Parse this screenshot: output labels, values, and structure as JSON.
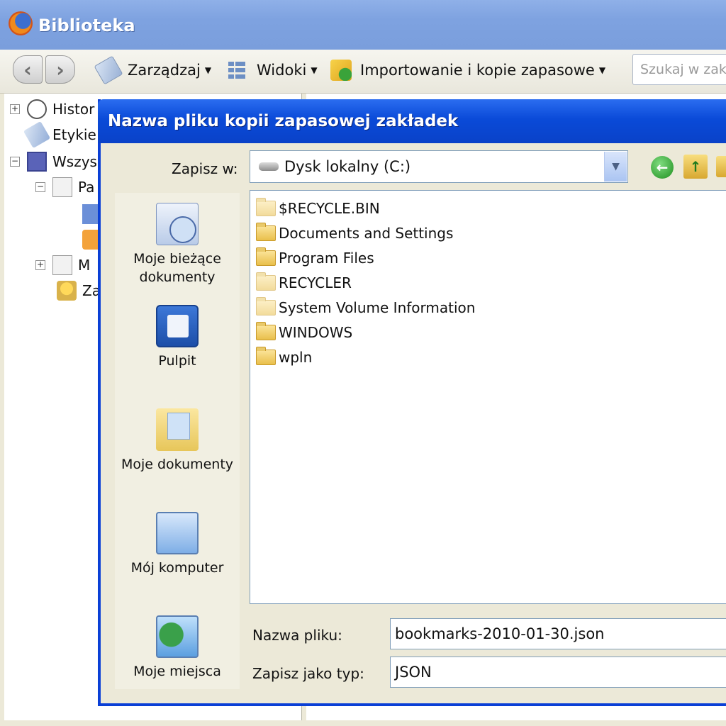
{
  "library": {
    "title": "Biblioteka",
    "toolbar": {
      "back": "‹",
      "forward": "›",
      "organize": "Zarządzaj",
      "views": "Widoki",
      "import_backup": "Importowanie i kopie zapasowe",
      "search_placeholder": "Szukaj w zakł"
    },
    "sidebar": {
      "items": [
        {
          "label": "Histor",
          "expander": "+"
        },
        {
          "label": "Etykie"
        },
        {
          "label": "Wszys",
          "expander": "−"
        },
        {
          "label": "Pa",
          "expander": "−"
        },
        {
          "label": ""
        },
        {
          "label": ""
        },
        {
          "label": "M",
          "expander": "+"
        },
        {
          "label": "Za"
        }
      ]
    }
  },
  "dialog": {
    "title": "Nazwa pliku kopii zapasowej zakładek",
    "save_in_label": "Zapisz w:",
    "save_in_value": "Dysk lokalny (C:)",
    "places": [
      {
        "label": "Moje bieżące\ndokumenty",
        "icon": "recent-documents-icon"
      },
      {
        "label": "Pulpit",
        "icon": "desktop-icon"
      },
      {
        "label": "Moje dokumenty",
        "icon": "my-documents-icon"
      },
      {
        "label": "Mój komputer",
        "icon": "my-computer-icon"
      },
      {
        "label": "Moje miejsca",
        "icon": "network-places-icon"
      }
    ],
    "files": [
      {
        "name": "$RECYCLE.BIN",
        "hidden": true
      },
      {
        "name": "Documents and Settings",
        "hidden": false
      },
      {
        "name": "Program Files",
        "hidden": false
      },
      {
        "name": "RECYCLER",
        "hidden": true
      },
      {
        "name": "System Volume Information",
        "hidden": true
      },
      {
        "name": "WINDOWS",
        "hidden": false
      },
      {
        "name": "wpln",
        "hidden": false
      }
    ],
    "filename_label": "Nazwa pliku:",
    "filename_value": "bookmarks-2010-01-30.json",
    "filetype_label": "Zapisz jako typ:",
    "filetype_value": "JSON"
  },
  "colors": {
    "dialog_title_bg": "#0a4ad8",
    "library_title_bg": "#7ea2e0",
    "window_bg": "#ece9d8"
  }
}
